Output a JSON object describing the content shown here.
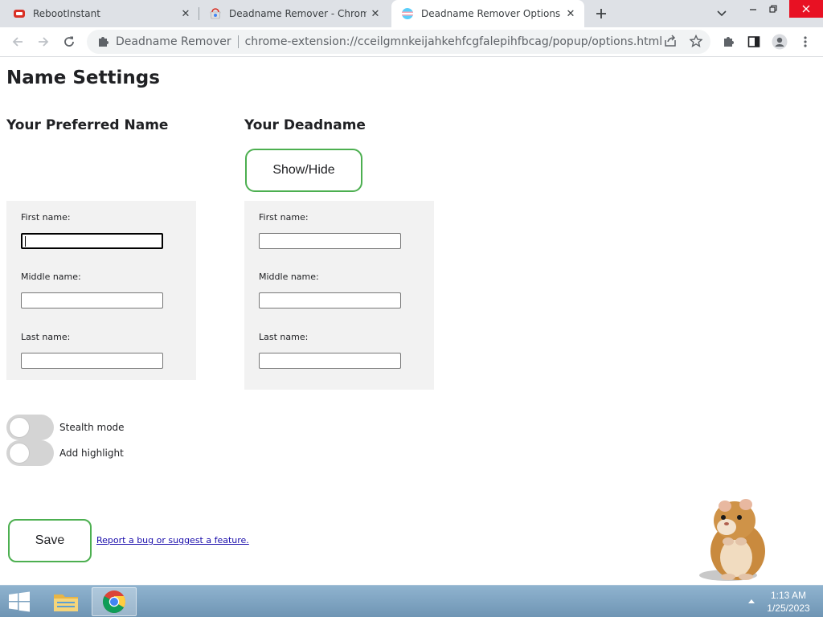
{
  "browser": {
    "tabs": [
      {
        "title": "RebootInstant",
        "icon": "rebootinstant-favicon",
        "active": false
      },
      {
        "title": "Deadname Remover - Chrome W",
        "icon": "chrome-webstore-favicon",
        "active": false
      },
      {
        "title": "Deadname Remover Options",
        "icon": "deadname-remover-favicon",
        "active": true
      }
    ],
    "new_tab_icon": "plus-icon",
    "omnibox": {
      "site_name": "Deadname Remover",
      "url": "chrome-extension://cceilgmnkeijahkehfcgfalepihfbcag/popup/options.html"
    }
  },
  "page": {
    "title": "Name Settings",
    "preferred": {
      "heading": "Your Preferred Name",
      "first_label": "First name:",
      "middle_label": "Middle name:",
      "last_label": "Last name:",
      "first_value": "",
      "middle_value": "",
      "last_value": ""
    },
    "deadname": {
      "heading": "Your Deadname",
      "show_hide_label": "Show/Hide",
      "first_label": "First name:",
      "middle_label": "Middle name:",
      "last_label": "Last name:",
      "first_value": "",
      "middle_value": "",
      "last_value": ""
    },
    "toggles": [
      {
        "label": "Stealth mode",
        "on": false
      },
      {
        "label": "Add highlight",
        "on": false
      }
    ],
    "save_label": "Save",
    "report_link": "Report a bug or suggest a feature."
  },
  "taskbar": {
    "time": "1:13 AM",
    "date": "1/25/2023",
    "apps": [
      "file-explorer-icon",
      "chrome-icon"
    ]
  },
  "colors": {
    "accent_green": "#4caf50",
    "panel_bg": "#f2f2f2",
    "link": "#1a0dab",
    "close_red": "#e81123"
  }
}
